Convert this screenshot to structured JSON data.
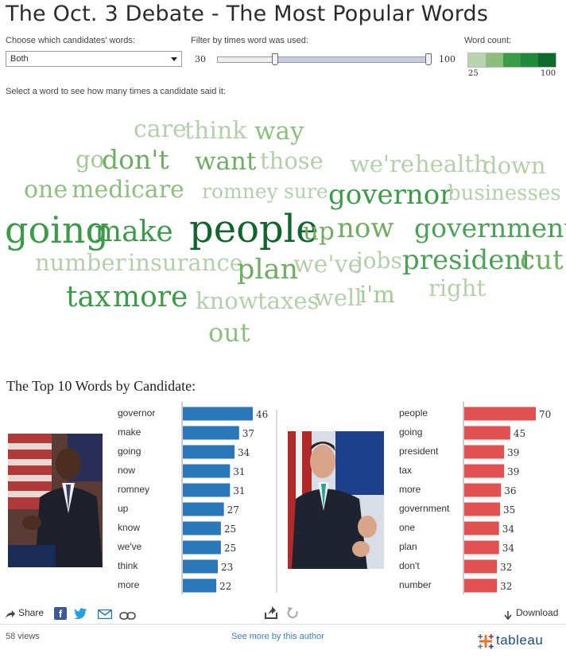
{
  "header": {
    "title": "The Oct. 3 Debate - The Most Popular Words"
  },
  "filters": {
    "candidate_label": "Choose which candidates' words:",
    "candidate_value": "Both",
    "times_label": "Filter by times word was used:",
    "range_min": "30",
    "range_max": "100",
    "range_fraction": [
      0.27,
      1.0
    ],
    "legend_label": "Word count:",
    "legend_min": "25",
    "legend_max": "100",
    "legend_colors": [
      "#b9d4b0",
      "#8ebe7e",
      "#3b9c48",
      "#1f8a3a",
      "#0f6b2c"
    ]
  },
  "instruction": "Select a word to see how many times a candidate said it:",
  "cloud_words": [
    {
      "text": "care",
      "color": "#b5cfac"
    },
    {
      "text": "think",
      "color": "#b5cfac"
    },
    {
      "text": "way",
      "color": "#8ebf7f"
    },
    {
      "text": "go",
      "color": "#a6c899"
    },
    {
      "text": "don't",
      "color": "#6fae62"
    },
    {
      "text": "want",
      "color": "#6fae62"
    },
    {
      "text": "those",
      "color": "#b5cfac"
    },
    {
      "text": "we're",
      "color": "#b5cfac"
    },
    {
      "text": "health",
      "color": "#b5cfac"
    },
    {
      "text": "down",
      "color": "#b5cfac"
    },
    {
      "text": "one",
      "color": "#8ebf7f"
    },
    {
      "text": "medicare",
      "color": "#8ebf7f"
    },
    {
      "text": "romney",
      "color": "#b5cfac"
    },
    {
      "text": "sure",
      "color": "#b5cfac"
    },
    {
      "text": "governor",
      "color": "#3d9a49"
    },
    {
      "text": "businesses",
      "color": "#b5cfac"
    },
    {
      "text": "going",
      "color": "#3d9a49"
    },
    {
      "text": "make",
      "color": "#3d9a49"
    },
    {
      "text": "people",
      "color": "#10652c"
    },
    {
      "text": "up",
      "color": "#6fae62"
    },
    {
      "text": "now",
      "color": "#6fae62"
    },
    {
      "text": "government",
      "color": "#4ba257"
    },
    {
      "text": "number",
      "color": "#b5cfac"
    },
    {
      "text": "insurance",
      "color": "#b5cfac"
    },
    {
      "text": "plan",
      "color": "#6fae62"
    },
    {
      "text": "we've",
      "color": "#b5cfac"
    },
    {
      "text": "jobs",
      "color": "#b5cfac"
    },
    {
      "text": "president",
      "color": "#4ba257"
    },
    {
      "text": "cut",
      "color": "#6fae62"
    },
    {
      "text": "tax",
      "color": "#3d9a49"
    },
    {
      "text": "more",
      "color": "#3d9a49"
    },
    {
      "text": "know",
      "color": "#b5cfac"
    },
    {
      "text": "taxes",
      "color": "#b5cfac"
    },
    {
      "text": "well",
      "color": "#b5cfac"
    },
    {
      "text": "i'm",
      "color": "#a6c899"
    },
    {
      "text": "right",
      "color": "#b5cfac"
    },
    {
      "text": "out",
      "color": "#8ebf7f"
    }
  ],
  "top10_title": "The Top 10 Words by Candidate:",
  "chart_data": [
    {
      "type": "bar",
      "orientation": "horizontal",
      "candidate_photo": "obama",
      "color": "#2a76b8",
      "categories": [
        "governor",
        "make",
        "going",
        "now",
        "romney",
        "up",
        "know",
        "we've",
        "think",
        "more"
      ],
      "values": [
        46,
        37,
        34,
        31,
        31,
        27,
        25,
        25,
        23,
        22
      ],
      "xlim": [
        0,
        50
      ]
    },
    {
      "type": "bar",
      "orientation": "horizontal",
      "candidate_photo": "romney",
      "color": "#e05252",
      "categories": [
        "people",
        "going",
        "president",
        "tax",
        "more",
        "government",
        "one",
        "plan",
        "don't",
        "number"
      ],
      "values": [
        70,
        45,
        39,
        39,
        36,
        35,
        34,
        34,
        32,
        32
      ],
      "xlim": [
        0,
        76
      ]
    }
  ],
  "toolbar": {
    "share": "Share",
    "download": "Download"
  },
  "footer": {
    "views": "58 views",
    "more": "See more by this author",
    "brand": "+tableau+"
  }
}
